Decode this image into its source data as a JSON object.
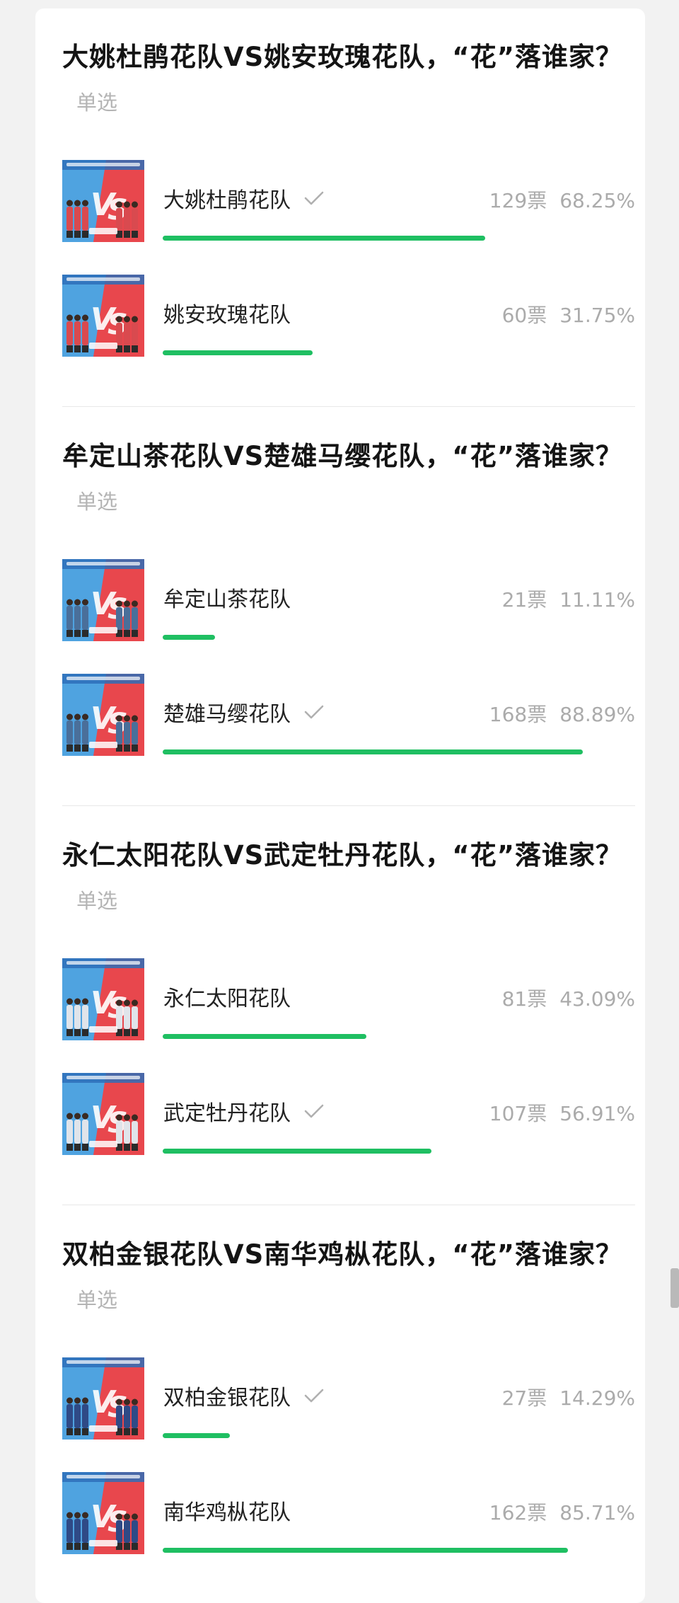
{
  "polls": [
    {
      "title": "大姚杜鹃花队VS姚安玫瑰花队，“花”落谁家？",
      "type": "单选",
      "options": [
        {
          "name": "大姚杜鹃花队",
          "checked": true,
          "votes": "129票",
          "percent": "68.25%",
          "fraction": 0.6825,
          "team_color": "#d94a4f"
        },
        {
          "name": "姚安玫瑰花队",
          "checked": false,
          "votes": "60票",
          "percent": "31.75%",
          "fraction": 0.3175,
          "team_color": "#d94a4f"
        }
      ]
    },
    {
      "title": "牟定山茶花队VS楚雄马缨花队，“花”落谁家？",
      "type": "单选",
      "options": [
        {
          "name": "牟定山茶花队",
          "checked": false,
          "votes": "21票",
          "percent": "11.11%",
          "fraction": 0.1111,
          "team_color": "#4a6f9a"
        },
        {
          "name": "楚雄马缨花队",
          "checked": true,
          "votes": "168票",
          "percent": "88.89%",
          "fraction": 0.8889,
          "team_color": "#4a6f9a"
        }
      ]
    },
    {
      "title": "永仁太阳花队VS武定牡丹花队，“花”落谁家？",
      "type": "单选",
      "options": [
        {
          "name": "永仁太阳花队",
          "checked": false,
          "votes": "81票",
          "percent": "43.09%",
          "fraction": 0.4309,
          "team_color": "#e0e4ea"
        },
        {
          "name": "武定牡丹花队",
          "checked": true,
          "votes": "107票",
          "percent": "56.91%",
          "fraction": 0.5691,
          "team_color": "#e0e4ea"
        }
      ]
    },
    {
      "title": "双柏金银花队VS南华鸡枞花队，“花”落谁家？",
      "type": "单选",
      "options": [
        {
          "name": "双柏金银花队",
          "checked": true,
          "votes": "27票",
          "percent": "14.29%",
          "fraction": 0.1429,
          "team_color": "#2f4a86"
        },
        {
          "name": "南华鸡枞花队",
          "checked": false,
          "votes": "162票",
          "percent": "85.71%",
          "fraction": 0.8571,
          "team_color": "#2f4a86"
        }
      ]
    }
  ],
  "colors": {
    "bar": "#1fbf62",
    "thumb_blue": "#4fa3e0",
    "thumb_red": "#e8474d",
    "check": "#b0b0b0"
  },
  "icons": {
    "check": "check-icon",
    "thumbnail": "vs-thumbnail"
  }
}
